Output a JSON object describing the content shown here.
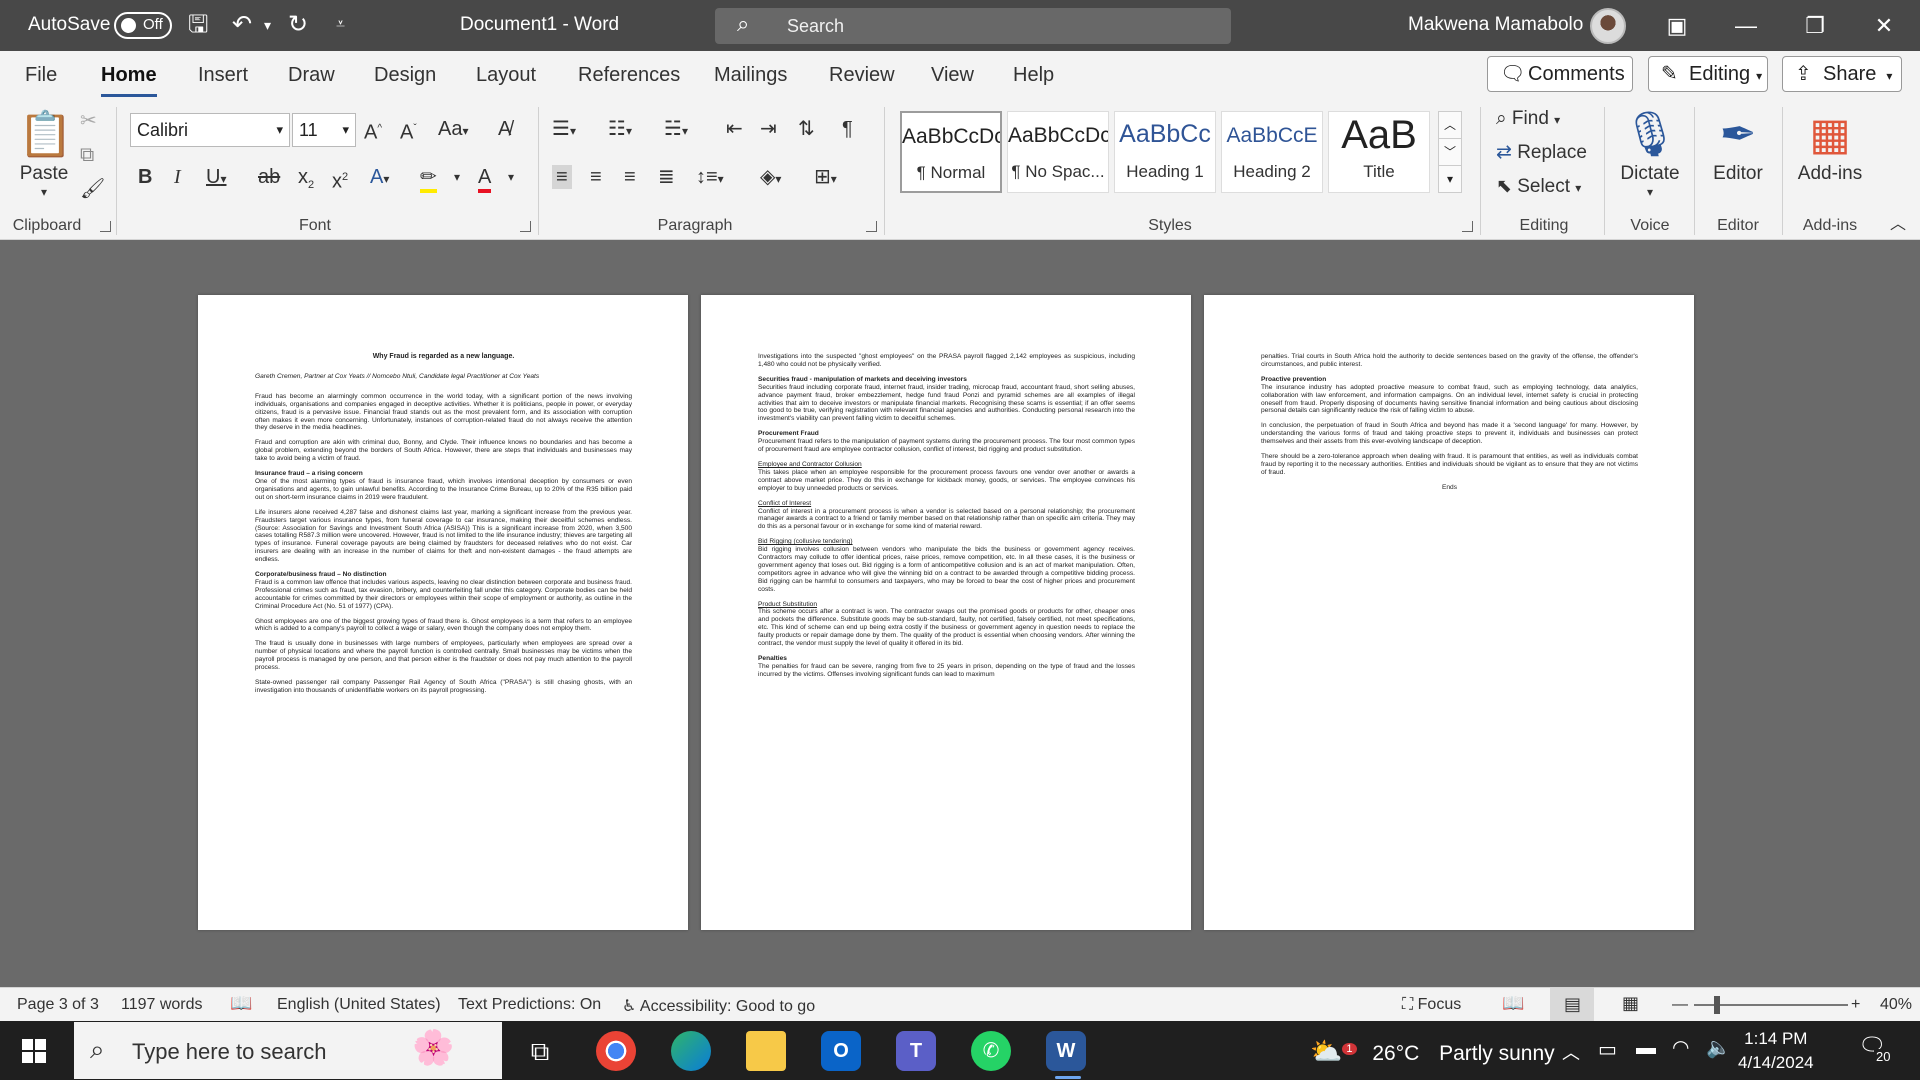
{
  "titlebar": {
    "autosave_label": "AutoSave",
    "autosave_state": "Off",
    "doc_title": "Document1  -  Word",
    "search_placeholder": "Search",
    "user_name": "Makwena Mamabolo"
  },
  "tabs": [
    "File",
    "Home",
    "Insert",
    "Draw",
    "Design",
    "Layout",
    "References",
    "Mailings",
    "Review",
    "View",
    "Help"
  ],
  "tab_buttons": {
    "comments": "Comments",
    "editing": "Editing",
    "share": "Share"
  },
  "ribbon": {
    "clipboard": {
      "paste": "Paste",
      "label": "Clipboard"
    },
    "font": {
      "name": "Calibri",
      "size": "11",
      "label": "Font"
    },
    "paragraph": {
      "label": "Paragraph"
    },
    "styles": {
      "label": "Styles",
      "items": [
        {
          "preview": "AaBbCcDc",
          "name": "¶ Normal"
        },
        {
          "preview": "AaBbCcDc",
          "name": "¶ No Spac..."
        },
        {
          "preview": "AaBbCc",
          "name": "Heading 1"
        },
        {
          "preview": "AaBbCcE",
          "name": "Heading 2"
        },
        {
          "preview": "AaB",
          "name": "Title"
        }
      ]
    },
    "editing": {
      "find": "Find",
      "replace": "Replace",
      "select": "Select",
      "label": "Editing"
    },
    "voice": {
      "dictate": "Dictate",
      "label": "Voice"
    },
    "editor": {
      "button": "Editor",
      "label": "Editor"
    },
    "addins": {
      "button": "Add-ins",
      "label": "Add-ins"
    }
  },
  "document": {
    "page1": {
      "title": "Why Fraud is regarded as a new language.",
      "byline": "Gareth Cremen, Partner at Cox Yeats // Nomcebo Ntuli, Candidate legal Practitioner at Cox Yeats",
      "p1": "Fraud has become an alarmingly common occurrence in the world today, with a significant portion of the news involving individuals, organisations and companies engaged in deceptive activities. Whether it is politicians, people in power, or everyday citizens, fraud is a pervasive issue. Financial fraud stands out as the most prevalent form, and its association with corruption often makes it even more concerning. Unfortunately, instances of corruption-related fraud do not always receive the attention they deserve in the media headlines.",
      "p2": "Fraud and corruption are akin with criminal duo, Bonny, and Clyde. Their influence knows no boundaries and has become a global problem, extending beyond the borders of South Africa. However, there are steps that individuals and businesses may take to avoid being a victim of fraud.",
      "h1": "Insurance fraud – a rising concern",
      "p3": "One of the most alarming types of fraud is insurance fraud, which involves intentional deception by consumers or even organisations and agents, to gain unlawful benefits. According to the Insurance Crime Bureau, up to 20% of the R35 billion paid out on short-term insurance claims in 2019 were fraudulent.",
      "p4": "Life insurers alone received 4,287 false and dishonest claims last year, marking a significant increase from the previous year. Fraudsters target various insurance types, from funeral coverage to car insurance, making their deceitful schemes endless. (Source: Association for Savings and Investment South Africa (ASISA)) This is a significant increase from 2020, when 3,500 cases totalling R587.3 million were uncovered. However, fraud is not limited to the life insurance industry; thieves are targeting all types of insurance. Funeral coverage payouts are being claimed by fraudsters for deceased relatives who do not exist. Car insurers are dealing with an increase in the number of claims for theft and non-existent damages - the fraud attempts are endless.",
      "h2": "Corporate/business fraud – No distinction",
      "p5": "Fraud is a common law offence that includes various aspects, leaving no clear distinction between corporate and business fraud. Professional crimes such as fraud, tax evasion, bribery, and counterfeiting fall under this category. Corporate bodies can be held accountable for crimes committed by their directors or employees within their scope of employment or authority, as outline in the Criminal Procedure Act (No. 51 of 1977) (CPA).",
      "p6": "Ghost employees are one of the biggest growing types of fraud there is. Ghost employees is a term that refers to an employee which is added to a company's payroll to collect a wage or salary, even though the company does not employ them.",
      "p7": "The fraud is usually done in businesses with large numbers of employees, particularly when employees are spread over a number of physical locations and where the payroll function is controlled centrally. Small businesses may be victims when the payroll process is managed by one person, and that person either is the fraudster or does not pay much attention to the payroll process.",
      "p8": "State-owned passenger rail company Passenger Rail Agency of South Africa (\"PRASA\") is still chasing ghosts, with an investigation into thousands of unidentifiable workers on its payroll progressing."
    },
    "page2": {
      "p1": "Investigations into the suspected \"ghost employees\" on the PRASA payroll flagged 2,142 employees as suspicious, including 1,480 who could not be physically verified.",
      "h1": "Securities fraud - manipulation of markets and deceiving investors",
      "p2": "Securities fraud including corporate fraud, internet fraud, insider trading, microcap fraud, accountant fraud, short selling abuses, advance payment fraud, broker embezzlement, hedge fund fraud Ponzi and pyramid schemes are all examples of illegal activities that aim to deceive investors or manipulate financial markets. Recognising these scams is essential; if an offer seems too good to be true, verifying registration with relevant financial agencies and authorities. Conducting personal research into the investment's viability can prevent falling victim to deceitful schemes.",
      "h2": "Procurement Fraud",
      "p3": "Procurement fraud refers to the manipulation of payment systems during the procurement process. The four most common types of procurement fraud are employee contractor collusion, conflict of interest, bid rigging and product substitution.",
      "u1": "Employee and Contractor Collusion",
      "p4": "This takes place when an employee responsible for the procurement process favours one vendor over another or awards a contract above market price. They do this in exchange for kickback money, goods, or services. The employee convinces his employer to buy unneeded products or services.",
      "u2": "Conflict of Interest",
      "p5": "Conflict of interest in a procurement process is when a vendor is selected based on a personal relationship; the procurement manager awards a contract to a friend or family member based on that relationship rather than on specific aim criteria. They may do this as a personal favour or in exchange for some kind of material reward.",
      "u3": "Bid Rigging (collusive tendering)",
      "p6": "Bid rigging involves collusion between vendors who manipulate the bids the business or government agency receives. Contractors may collude to offer identical prices, raise prices, remove competition, etc. In all these cases, it is the business or government agency that loses out. Bid rigging is a form of anticompetitive collusion and is an act of market manipulation. Often, competitors agree in advance who will give the winning bid on a contract to be awarded through a competitive bidding process. Bid rigging can be harmful to consumers and taxpayers, who may be forced to bear the cost of higher prices and procurement costs.",
      "u4": "Product Substitution",
      "p7": "This scheme occurs after a contract is won. The contractor swaps out the promised goods or products for other, cheaper ones and pockets the difference. Substitute goods may be sub-standard, faulty, not certified, falsely certified, not meet specifications, etc. This kind of scheme can end up being extra costly if the business or government agency in question needs to replace the faulty products or repair damage done by them. The quality of the product is essential when choosing vendors. After winning the contract, the vendor must supply the level of quality it offered in its bid.",
      "h3": "Penalties",
      "p8": "The penalties for fraud can be severe, ranging from five to 25 years in prison, depending on the type of fraud and the losses incurred by the victims. Offenses involving significant funds can lead to maximum"
    },
    "page3": {
      "p1": "penalties. Trial courts in South Africa hold the authority to decide sentences based on the gravity of the offense, the offender's circumstances, and public interest.",
      "h1": "Proactive prevention",
      "p2": "The insurance industry has adopted proactive measure to combat fraud, such as employing technology, data analytics, collaboration with law enforcement, and information campaigns. On an individual level, internet safety is crucial in protecting oneself from fraud. Properly disposing of documents having sensitive financial information and being cautious about disclosing personal details can significantly reduce the risk of falling victim to abuse.",
      "p3": "In conclusion, the perpetuation of fraud in South Africa and beyond has made it a 'second language' for many. However, by understanding the various forms of fraud and taking proactive steps to prevent it, individuals and businesses can protect themselves and their assets from this ever-evolving landscape of deception.",
      "p4": "There should be a zero-tolerance approach when dealing with fraud. It is paramount that entities, as well as individuals combat fraud by reporting it to the necessary authorities. Entities and individuals should be vigilant as to ensure that they are not victims of fraud.",
      "ends": "Ends"
    }
  },
  "statusbar": {
    "page": "Page 3 of 3",
    "words": "1197 words",
    "language": "English (United States)",
    "predictions": "Text Predictions: On",
    "accessibility": "Accessibility: Good to go",
    "focus": "Focus",
    "zoom": "40%"
  },
  "taskbar": {
    "search_placeholder": "Type here to search",
    "temperature": "26°C",
    "weather": "Partly sunny",
    "time": "1:14 PM",
    "date": "4/14/2024",
    "notifications": "20",
    "weather_badge": "1"
  },
  "colors": {
    "accent": "#2b579a",
    "titlebar": "#484848",
    "ribbon": "#f3f3f3",
    "canvas": "#6a6a6a"
  }
}
